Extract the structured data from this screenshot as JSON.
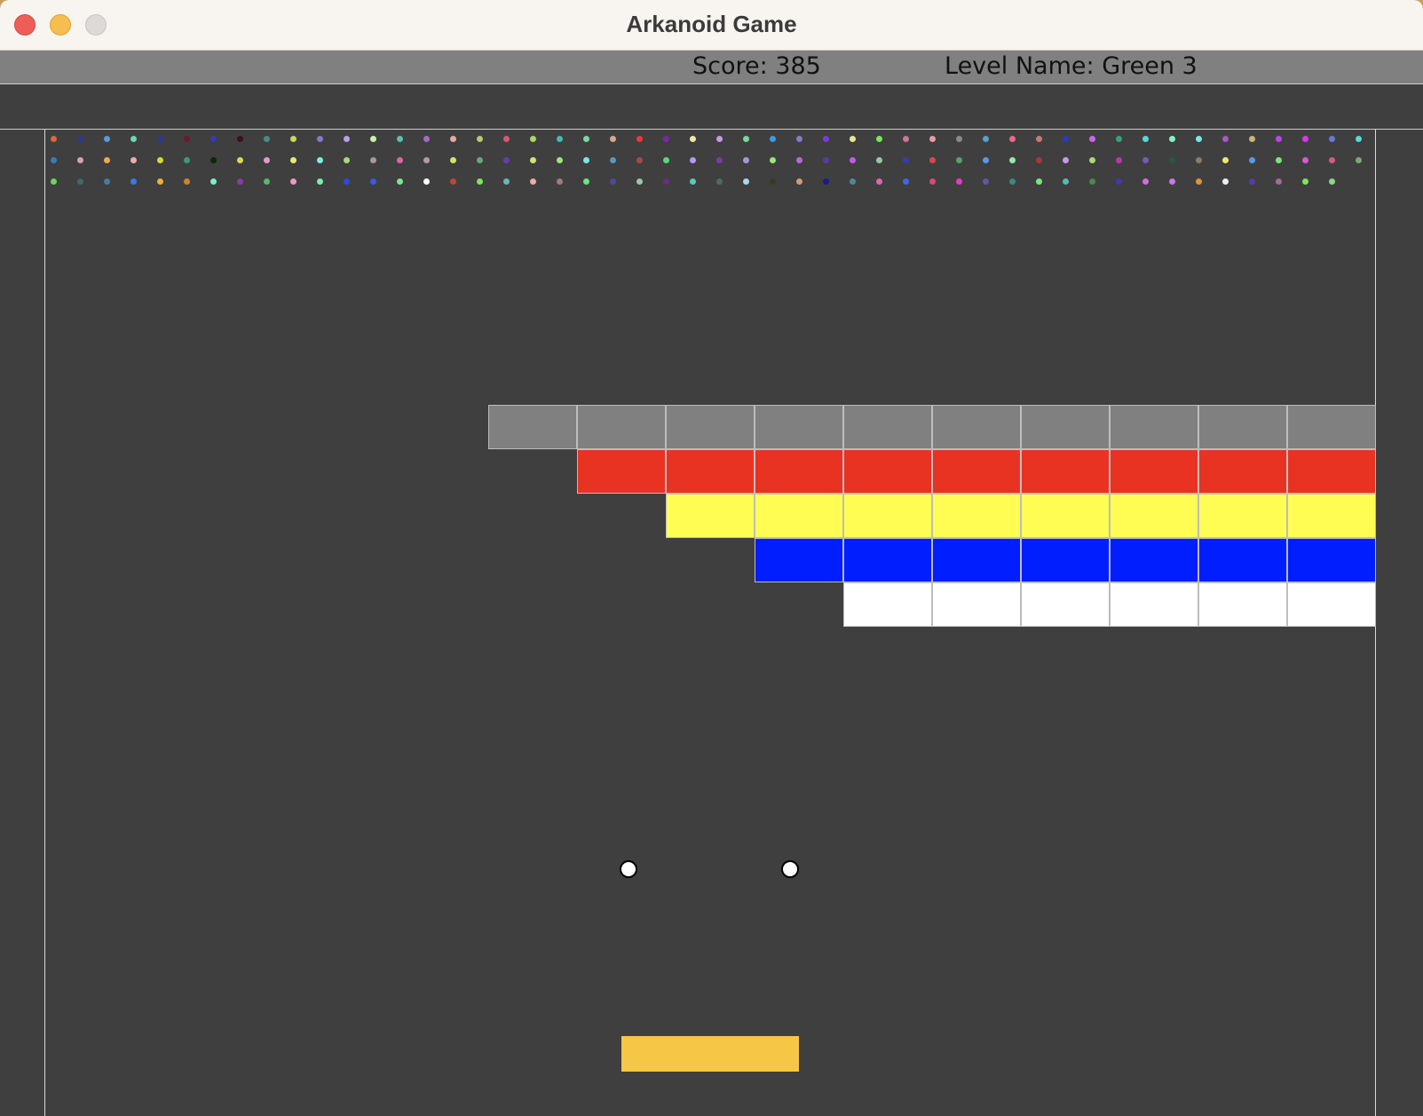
{
  "window": {
    "title": "Arkanoid Game",
    "controls": [
      "close-button",
      "minimize-button",
      "zoom-button"
    ]
  },
  "hud": {
    "score_text": "Score: 385",
    "level_text": "Level Name: Green 3"
  },
  "colors": {
    "background": "#3f3f3f",
    "hud_bar": "#808080",
    "paddle": "#f6c646",
    "ball": "#ffffff"
  },
  "brick_rows": [
    {
      "color": "#808080",
      "count": 10
    },
    {
      "color": "#e83323",
      "count": 9
    },
    {
      "color": "#fffc54",
      "count": 8
    },
    {
      "color": "#001eff",
      "count": 7
    },
    {
      "color": "#ffffff",
      "count": 6
    }
  ],
  "balls": 2,
  "confetti_rows": [
    [
      "#d9683c",
      "#2a3a8c",
      "#5a9ad8",
      "#6bd8b0",
      "#2a3a8c",
      "#6a1a2a",
      "#3a3ab0",
      "#3a1020",
      "#4a8a8a",
      "#c8d858",
      "#8a78c8",
      "#b8a0e8",
      "#c8f0b0",
      "#58c0b0",
      "#a868c8",
      "#e8a8a0",
      "#b8c878",
      "#d85878",
      "#a8d860",
      "#4ab8b0",
      "#78d8a0",
      "#d8a888",
      "#e83838",
      "#7a2aa0",
      "#f0e8a8",
      "#c898e8",
      "#78d898",
      "#3a9ae8",
      "#8a78c8",
      "#7a3ad8",
      "#e8e890",
      "#78e858",
      "#c87898",
      "#e89aa8",
      "#8a8a8a",
      "#5aa0c8",
      "#e86890",
      "#c87878",
      "#2a3ac0",
      "#c868e8",
      "#3aa078",
      "#58d8d8",
      "#88f0c8",
      "#78e8e8",
      "#a858c8",
      "#c8b878",
      "#b848e8",
      "#d838e8",
      "#6a78d8",
      "#58d8d8"
    ],
    [
      "#3a7ab8",
      "#d8a0b0",
      "#f0a850",
      "#e8b0b0",
      "#d8d838",
      "#3a9a78",
      "#0a2a0a",
      "#d8d858",
      "#e898c8",
      "#e8e878",
      "#78f0d8",
      "#a8d878",
      "#a89898",
      "#d868a8",
      "#b898a8",
      "#c8e868",
      "#68a878",
      "#6a3ab0",
      "#c8e878",
      "#98e878",
      "#78e8f0",
      "#5a98b8",
      "#a84848",
      "#58d878",
      "#b898f0",
      "#7a3aa8",
      "#a898d8",
      "#98e878",
      "#b868d8",
      "#5a3aa0",
      "#c858f0",
      "#98c8a0",
      "#3a3ab0",
      "#d84848",
      "#5aa068",
      "#5a98e8",
      "#98e8a8",
      "#a83838",
      "#c898f0",
      "#a8d878",
      "#b838a8",
      "#7a58b8",
      "#2a5a3a",
      "#8a7a68",
      "#f0e868",
      "#5a98e8",
      "#78e878",
      "#d858d8",
      "#d85888",
      "#78a878"
    ],
    [
      "#68d858",
      "#3a6a6a",
      "#4a7aa8",
      "#3a78e8",
      "#f0b030",
      "#c88828",
      "#78f0c8",
      "#8a3aa8",
      "#58b868",
      "#e898c8",
      "#78f0a8",
      "#2a48e8",
      "#3a58e8",
      "#78e888",
      "#ffffff",
      "#b84838",
      "#78e858",
      "#68b8b8",
      "#f0a8a8",
      "#a87878",
      "#68e878",
      "#4a4a98",
      "#98c8a0",
      "#6a2a8a",
      "#58c8b8",
      "#4a6a68",
      "#a8d8f0",
      "#3a3a1a",
      "#d89878",
      "#1a1a8a",
      "#4a8a98",
      "#d868b8",
      "#3a68e8",
      "#d84878",
      "#e838c8",
      "#5a5aa8",
      "#3a8888",
      "#78e878",
      "#58b8b8",
      "#4a8a4a",
      "#3a3ab8",
      "#d868e8",
      "#c878e8",
      "#d89838",
      "#e8f0f8",
      "#5a3aa8",
      "#a86898",
      "#78e858",
      "#88d888"
    ]
  ]
}
